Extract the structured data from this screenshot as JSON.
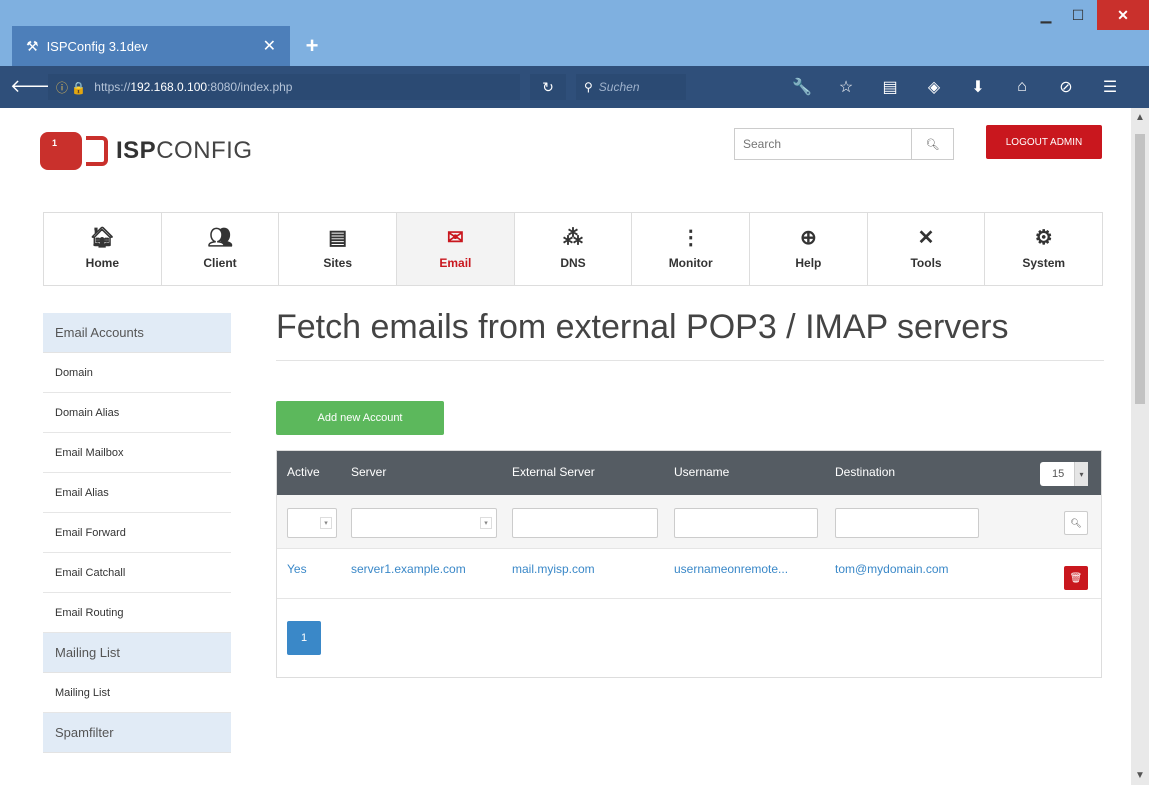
{
  "browser": {
    "tab_title": "ISPConfig 3.1dev",
    "tab_close": "✕",
    "new_tab": "+",
    "url_prefix": "https://",
    "url_host": "192.168.0.100",
    "url_rest": ":8080/index.php",
    "search_placeholder": "Suchen"
  },
  "header": {
    "logo_badge": "1",
    "logo_bold": "ISP",
    "logo_light": "CONFIG",
    "search_placeholder": "Search",
    "logout_label": "LOGOUT ADMIN"
  },
  "modules": [
    {
      "label": "Home",
      "icon": "home-icon"
    },
    {
      "label": "Client",
      "icon": "users-icon"
    },
    {
      "label": "Sites",
      "icon": "sites-icon"
    },
    {
      "label": "Email",
      "icon": "email-icon"
    },
    {
      "label": "DNS",
      "icon": "dns-icon"
    },
    {
      "label": "Monitor",
      "icon": "monitor-icon"
    },
    {
      "label": "Help",
      "icon": "help-icon"
    },
    {
      "label": "Tools",
      "icon": "tools-icon"
    },
    {
      "label": "System",
      "icon": "system-icon"
    }
  ],
  "active_module": "Email",
  "sidebar": {
    "section1": "Email Accounts",
    "items1": [
      "Domain",
      "Domain Alias",
      "Email Mailbox",
      "Email Alias",
      "Email Forward",
      "Email Catchall",
      "Email Routing"
    ],
    "section2": "Mailing List",
    "items2": [
      "Mailing List"
    ],
    "section3": "Spamfilter"
  },
  "main": {
    "title": "Fetch emails from external POP3 / IMAP servers",
    "add_button": "Add new Account",
    "columns": [
      "Active",
      "Server",
      "External Server",
      "Username",
      "Destination"
    ],
    "page_size": "15",
    "rows": [
      {
        "active": "Yes",
        "server": "server1.example.com",
        "external_server": "mail.myisp.com",
        "username": "usernameonremote...",
        "destination": "tom@mydomain.com"
      }
    ],
    "current_page": "1"
  },
  "colors": {
    "accent_red": "#c9171e",
    "link_blue": "#3a88c8",
    "success_green": "#5cb85c",
    "table_header": "#555c63"
  }
}
